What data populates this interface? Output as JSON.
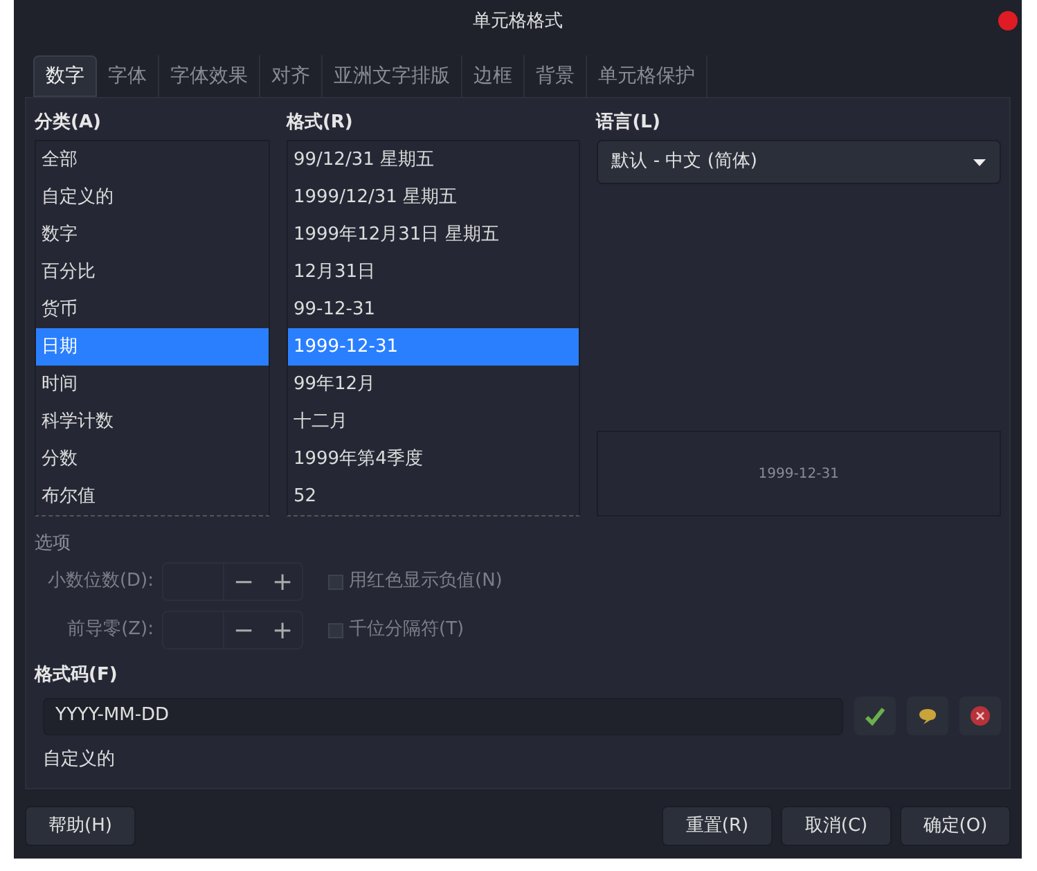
{
  "window": {
    "title": "单元格格式"
  },
  "tabs": [
    {
      "label": "数字",
      "selected": true
    },
    {
      "label": "字体",
      "selected": false
    },
    {
      "label": "字体效果",
      "selected": false
    },
    {
      "label": "对齐",
      "selected": false
    },
    {
      "label": "亚洲文字排版",
      "selected": false
    },
    {
      "label": "边框",
      "selected": false
    },
    {
      "label": "背景",
      "selected": false
    },
    {
      "label": "单元格保护",
      "selected": false
    }
  ],
  "category": {
    "label": "分类(A)",
    "items": [
      {
        "label": "全部",
        "selected": false
      },
      {
        "label": "自定义的",
        "selected": false
      },
      {
        "label": "数字",
        "selected": false
      },
      {
        "label": "百分比",
        "selected": false
      },
      {
        "label": "货币",
        "selected": false
      },
      {
        "label": "日期",
        "selected": true
      },
      {
        "label": "时间",
        "selected": false
      },
      {
        "label": "科学计数",
        "selected": false
      },
      {
        "label": "分数",
        "selected": false
      },
      {
        "label": "布尔值",
        "selected": false
      }
    ]
  },
  "format": {
    "label": "格式(R)",
    "items": [
      {
        "label": "99/12/31 星期五",
        "selected": false
      },
      {
        "label": "1999/12/31 星期五",
        "selected": false
      },
      {
        "label": "1999年12月31日 星期五",
        "selected": false
      },
      {
        "label": "12月31日",
        "selected": false
      },
      {
        "label": "99-12-31",
        "selected": false
      },
      {
        "label": "1999-12-31",
        "selected": true
      },
      {
        "label": "99年12月",
        "selected": false
      },
      {
        "label": "十二月",
        "selected": false
      },
      {
        "label": "1999年第4季度",
        "selected": false
      },
      {
        "label": "52",
        "selected": false
      }
    ]
  },
  "language": {
    "label": "语言(L)",
    "value": "默认 - 中文 (简体)"
  },
  "preview": "1999-12-31",
  "options": {
    "label": "选项",
    "rows": [
      {
        "label": "小数位数(D):",
        "minus": "−",
        "plus": "+",
        "checkbox": "用红色显示负值(N)",
        "checked": false
      },
      {
        "label": "前导零(Z):",
        "minus": "−",
        "plus": "+",
        "checkbox": "千位分隔符(T)",
        "checked": false
      }
    ]
  },
  "format_code": {
    "label": "格式码(F)",
    "value": "YYYY-MM-DD",
    "description": "自定义的"
  },
  "buttons": {
    "help": "帮助(H)",
    "right": [
      "重置(R)",
      "取消(C)",
      "确定(O)"
    ]
  }
}
